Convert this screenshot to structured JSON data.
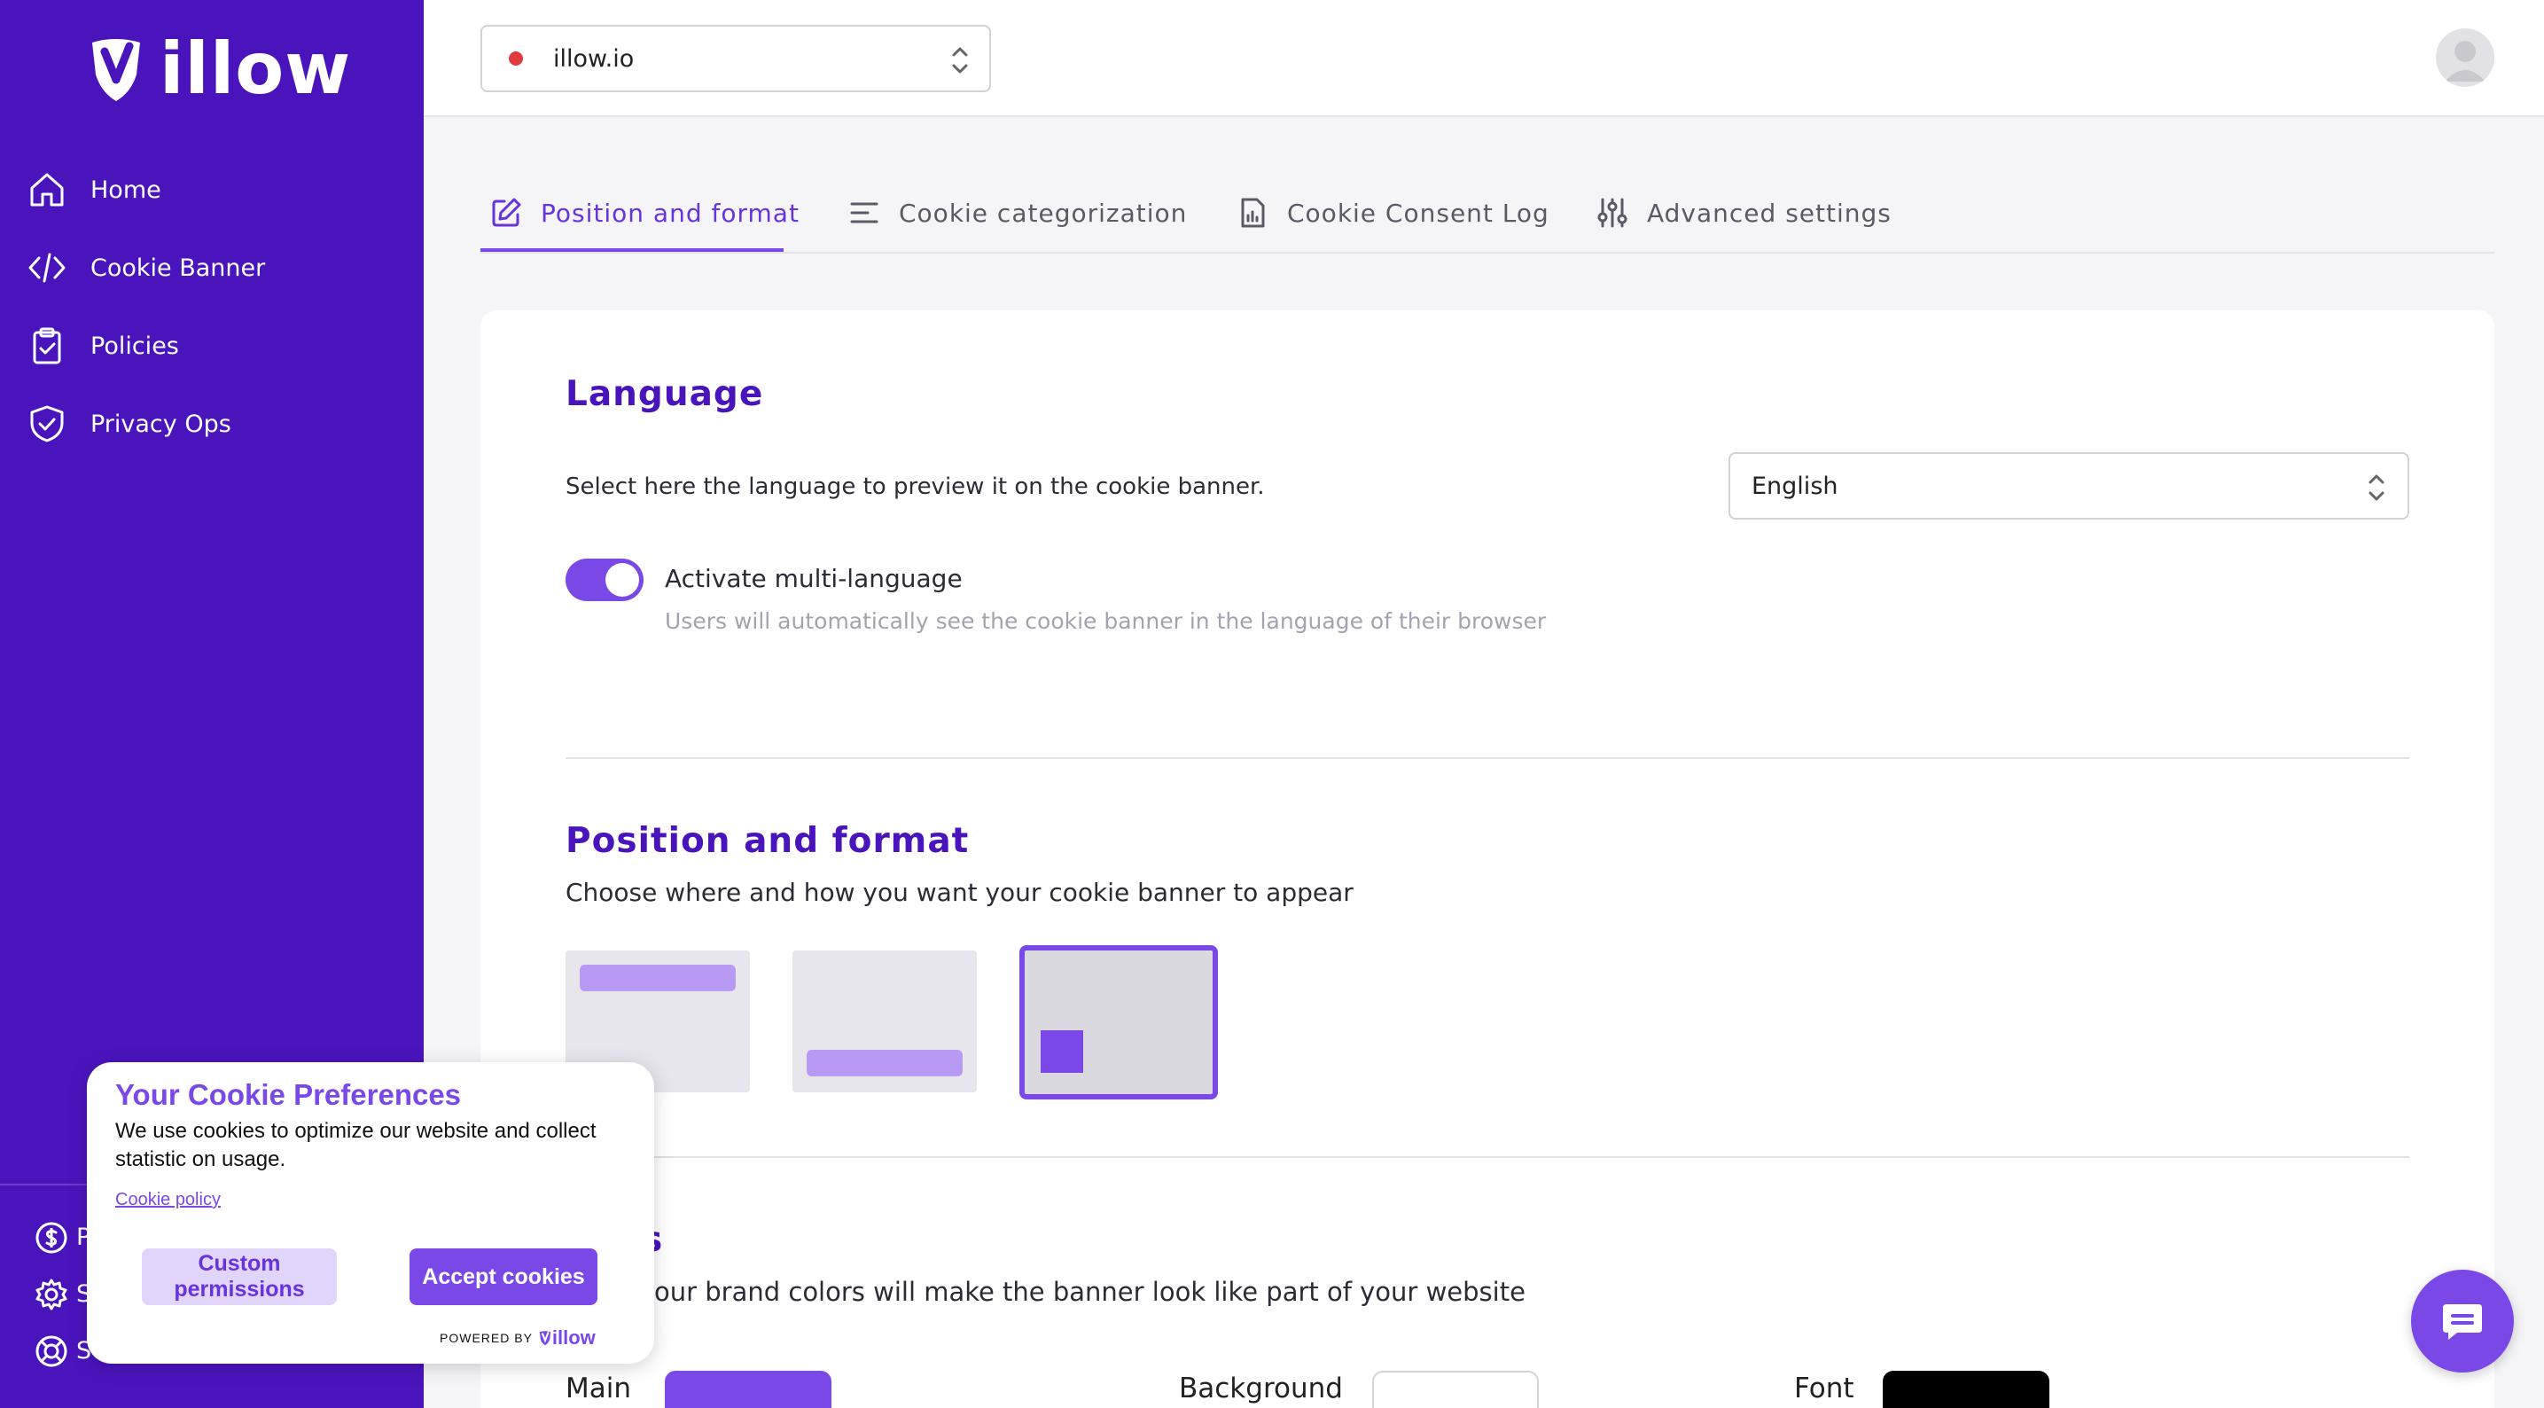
{
  "brand": {
    "name": "illow",
    "accent": "#7b48e8",
    "sidebar_bg": "#4a14bd"
  },
  "sidebar": {
    "items": [
      {
        "label": "Home",
        "icon": "home-icon"
      },
      {
        "label": "Cookie Banner",
        "icon": "code-icon"
      },
      {
        "label": "Policies",
        "icon": "clipboard-check-icon"
      },
      {
        "label": "Privacy Ops",
        "icon": "shield-check-icon"
      }
    ],
    "bottom_items": [
      {
        "label": "P",
        "icon": "dollar-circle-icon"
      },
      {
        "label": "S",
        "icon": "gear-icon"
      },
      {
        "label": "S",
        "icon": "lifebuoy-icon"
      }
    ]
  },
  "topbar": {
    "site_select": {
      "value": "illow.io",
      "status_color": "#e0393e"
    },
    "avatar": "user-avatar-icon"
  },
  "tabs": [
    {
      "label": "Position and format",
      "icon": "edit-icon",
      "active": true
    },
    {
      "label": "Cookie categorization",
      "icon": "list-icon",
      "active": false
    },
    {
      "label": "Cookie Consent Log",
      "icon": "file-chart-icon",
      "active": false
    },
    {
      "label": "Advanced settings",
      "icon": "sliders-icon",
      "active": false
    }
  ],
  "language": {
    "title": "Language",
    "description": "Select here the language to preview it on the cookie banner.",
    "selected": "English",
    "multi_language": {
      "enabled": true,
      "label": "Activate multi-language",
      "help": "Users will automatically see the cookie banner in the language of their browser"
    }
  },
  "position": {
    "title": "Position and format",
    "description": "Choose where and how you want your cookie banner to appear",
    "selected_option": 3
  },
  "colors": {
    "title_visible": "s",
    "description_visible": "our brand colors will make the banner look like part of your website",
    "fields": [
      {
        "label": "Main",
        "value": "#7b48e8"
      },
      {
        "label": "Background",
        "value": "#ffffff"
      },
      {
        "label": "Font",
        "value": "#000000"
      }
    ]
  },
  "cookie_popup": {
    "title": "Your Cookie Preferences",
    "body": "We use cookies to optimize our website and collect statistic on usage.",
    "link": "Cookie policy",
    "custom_button": "Custom permissions",
    "accept_button": "Accept cookies",
    "powered_by": "POWERED BY",
    "powered_logo": "illow"
  },
  "chat": {
    "icon": "chat-icon"
  }
}
